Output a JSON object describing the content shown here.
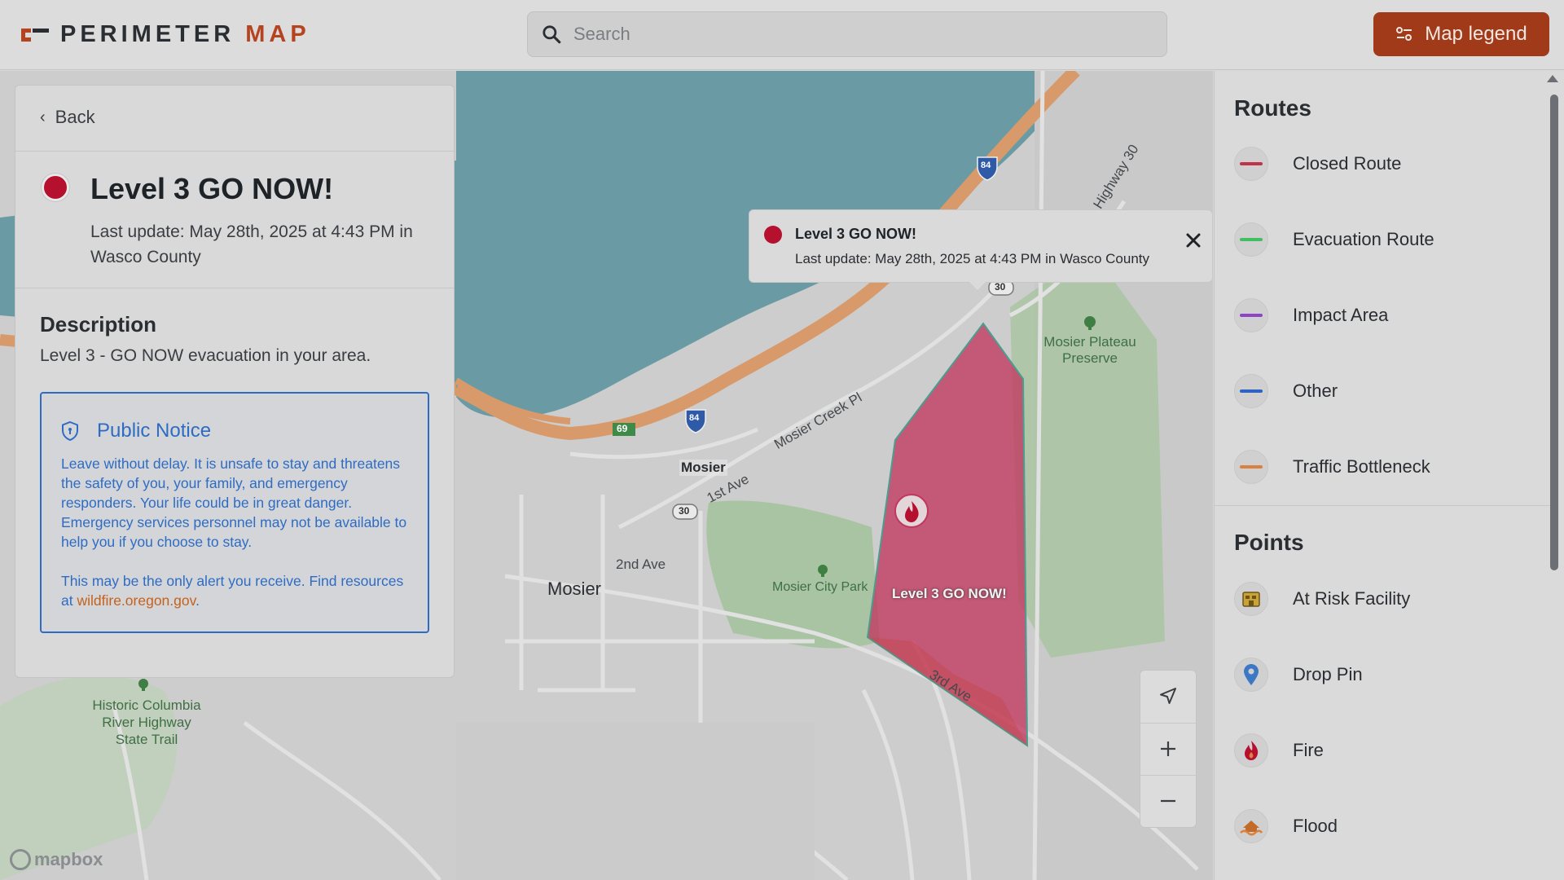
{
  "header": {
    "brand_primary": "PERIMETER",
    "brand_accent": "MAP",
    "search_placeholder": "Search",
    "legend_button": "Map legend",
    "brand_color": "#a13a19"
  },
  "panel": {
    "back_label": "Back",
    "alert_title": "Level 3 GO NOW!",
    "alert_update": "Last update: May 28th, 2025 at 4:43 PM in Wasco County",
    "description_title": "Description",
    "description_text": "Level 3 - GO NOW evacuation in your area.",
    "notice_title": "Public Notice",
    "notice_paragraph1": "Leave without delay. It is unsafe to stay and threatens the safety of you, your family, and emergency responders. Your life could be in great danger. Emergency services personnel may not be available to help you if you choose to stay.",
    "notice_paragraph2_prefix": "This may be the only alert you receive. Find resources at ",
    "notice_link": "wildfire.oregon.gov",
    "notice_paragraph2_suffix": ".",
    "alert_color": "#b5102e"
  },
  "popup": {
    "title": "Level 3 GO NOW!",
    "text": "Last update: May 28th, 2025 at 4:43 PM in Wasco County"
  },
  "map": {
    "labels": {
      "mosier_small": "Mosier",
      "mosier_large": "Mosier",
      "mosier_creek_pl": "Mosier Creek Pl",
      "first_ave": "1st Ave",
      "second_ave": "2nd Ave",
      "third_ave": "3rd Ave",
      "highway_30": "Highway 30",
      "mosier_plateau_preserve_1": "Mosier Plateau",
      "mosier_plateau_preserve_2": "Preserve",
      "mosier_city_park": "Mosier City Park",
      "historic_trail_1": "Historic Columbia",
      "historic_trail_2": "River Highway",
      "historic_trail_3": "State Trail",
      "zone_label": "Level 3 GO NOW!",
      "shield_84a": "84",
      "shield_84b": "84",
      "shield_30a": "30",
      "shield_30b": "30",
      "exit_69": "69"
    },
    "attribution": "mapbox"
  },
  "legend": {
    "routes_title": "Routes",
    "routes": [
      {
        "label": "Closed Route",
        "color": "#c0334a"
      },
      {
        "label": "Evacuation Route",
        "color": "#3fbf5f"
      },
      {
        "label": "Impact Area",
        "color": "#8e44c9"
      },
      {
        "label": "Other",
        "color": "#2e62c4"
      },
      {
        "label": "Traffic Bottleneck",
        "color": "#d9823f"
      }
    ],
    "points_title": "Points",
    "points": [
      {
        "label": "At Risk Facility",
        "icon": "facility-icon"
      },
      {
        "label": "Drop Pin",
        "icon": "pin-icon"
      },
      {
        "label": "Fire",
        "icon": "fire-icon"
      },
      {
        "label": "Flood",
        "icon": "flood-icon"
      }
    ]
  }
}
